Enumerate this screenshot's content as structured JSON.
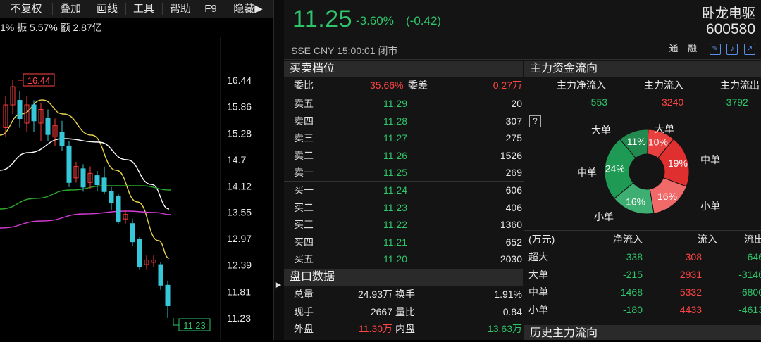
{
  "menu": [
    "不复权",
    "叠加",
    "画线",
    "工具",
    "帮助",
    "F9",
    "隐藏▶"
  ],
  "stat_line": "1% 振 5.57% 额 2.87亿",
  "kline": {
    "price_labels": [
      "16.44",
      "15.86",
      "15.28",
      "14.7",
      "14.12",
      "13.55",
      "12.97",
      "12.39",
      "11.81",
      "11.23"
    ],
    "high_tag": "16.44",
    "low_tag": "11.23",
    "candles": [
      {
        "o": 15.4,
        "c": 15.9,
        "h": 16.1,
        "l": 15.2,
        "up": true
      },
      {
        "o": 15.9,
        "c": 16.3,
        "h": 16.44,
        "l": 15.7,
        "up": true
      },
      {
        "o": 16.0,
        "c": 15.6,
        "h": 16.2,
        "l": 15.4,
        "up": false
      },
      {
        "o": 15.5,
        "c": 15.9,
        "h": 16.1,
        "l": 15.3,
        "up": true
      },
      {
        "o": 15.9,
        "c": 15.55,
        "h": 16.0,
        "l": 15.3,
        "up": false
      },
      {
        "o": 15.5,
        "c": 15.8,
        "h": 15.95,
        "l": 15.1,
        "up": true
      },
      {
        "o": 15.6,
        "c": 15.25,
        "h": 15.8,
        "l": 15.1,
        "up": false
      },
      {
        "o": 15.2,
        "c": 15.45,
        "h": 15.6,
        "l": 15.0,
        "up": true
      },
      {
        "o": 15.3,
        "c": 15.0,
        "h": 15.55,
        "l": 14.9,
        "up": false
      },
      {
        "o": 15.0,
        "c": 14.2,
        "h": 15.1,
        "l": 14.1,
        "up": false
      },
      {
        "o": 14.3,
        "c": 14.55,
        "h": 14.65,
        "l": 14.2,
        "up": true
      },
      {
        "o": 14.5,
        "c": 14.1,
        "h": 14.6,
        "l": 14.0,
        "up": false
      },
      {
        "o": 14.2,
        "c": 14.4,
        "h": 14.55,
        "l": 14.05,
        "up": true
      },
      {
        "o": 14.35,
        "c": 14.15,
        "h": 14.45,
        "l": 14.0,
        "up": false
      },
      {
        "o": 14.3,
        "c": 14.0,
        "h": 14.55,
        "l": 13.95,
        "up": false
      },
      {
        "o": 14.0,
        "c": 13.75,
        "h": 14.1,
        "l": 13.6,
        "up": false
      },
      {
        "o": 13.9,
        "c": 13.35,
        "h": 13.95,
        "l": 13.3,
        "up": false
      },
      {
        "o": 13.4,
        "c": 13.5,
        "h": 13.6,
        "l": 13.3,
        "up": true
      },
      {
        "o": 13.3,
        "c": 12.9,
        "h": 13.4,
        "l": 12.8,
        "up": false
      },
      {
        "o": 12.95,
        "c": 12.35,
        "h": 13.0,
        "l": 12.3,
        "up": false
      },
      {
        "o": 12.4,
        "c": 12.5,
        "h": 12.6,
        "l": 12.3,
        "up": true
      },
      {
        "o": 12.5,
        "c": 12.45,
        "h": 12.6,
        "l": 12.35,
        "up": true
      },
      {
        "o": 12.4,
        "c": 11.95,
        "h": 12.45,
        "l": 11.85,
        "up": false
      },
      {
        "o": 11.95,
        "c": 11.5,
        "h": 12.05,
        "l": 11.23,
        "up": false
      }
    ]
  },
  "quote": {
    "price": "11.25",
    "pct": "-3.60%",
    "change": "(-0.42)",
    "name": "卧龙电驱",
    "code": "600580",
    "exchange_line": "SSE  CNY  15:00:01  闭市",
    "badge1": "通",
    "badge2": "融"
  },
  "orderbook": {
    "title": "买卖档位",
    "ratio_label": "委比",
    "ratio_value": "35.66%",
    "diff_label": "委差",
    "diff_value": "0.27万",
    "asks": [
      {
        "label": "卖五",
        "price": "11.29",
        "vol": "20"
      },
      {
        "label": "卖四",
        "price": "11.28",
        "vol": "307"
      },
      {
        "label": "卖三",
        "price": "11.27",
        "vol": "275"
      },
      {
        "label": "卖二",
        "price": "11.26",
        "vol": "1526"
      },
      {
        "label": "卖一",
        "price": "11.25",
        "vol": "269"
      }
    ],
    "bids": [
      {
        "label": "买一",
        "price": "11.24",
        "vol": "606"
      },
      {
        "label": "买二",
        "price": "11.23",
        "vol": "406"
      },
      {
        "label": "买三",
        "price": "11.22",
        "vol": "1360"
      },
      {
        "label": "买四",
        "price": "11.21",
        "vol": "652"
      },
      {
        "label": "买五",
        "price": "11.20",
        "vol": "2030"
      }
    ]
  },
  "market": {
    "title": "盘口数据",
    "rows": [
      {
        "l1": "总量",
        "v1": "24.93万",
        "l2": "换手",
        "v2": "1.91%"
      },
      {
        "l1": "现手",
        "v1": "2667",
        "l2": "量比",
        "v2": "0.84"
      },
      {
        "l1": "外盘",
        "v1": "11.30万",
        "l2": "内盘",
        "v2": "13.63万"
      }
    ]
  },
  "capital": {
    "title": "主力资金流向",
    "head": [
      "主力净流入",
      "主力流入",
      "主力流出"
    ],
    "values": [
      "-553",
      "3240",
      "-3792"
    ],
    "help": "?",
    "pie": [
      {
        "name": "大单",
        "pct": "10%",
        "value": 10,
        "color": "#e8403e"
      },
      {
        "name": "中单",
        "pct": "19%",
        "value": 19,
        "color": "#e02f2f"
      },
      {
        "name": "小单",
        "pct": "16%",
        "value": 16,
        "color": "#f06a6a"
      },
      {
        "name": "小单",
        "pct": "16%",
        "value": 16,
        "color": "#3fae73"
      },
      {
        "name": "中单",
        "pct": "24%",
        "value": 24,
        "color": "#1f9a55"
      },
      {
        "name": "大单",
        "pct": "11%",
        "value": 11,
        "color": "#22894f"
      }
    ],
    "table_head": [
      "(万元)",
      "净流入",
      "流入",
      "流出"
    ],
    "table": [
      {
        "k": "超大",
        "net": "-338",
        "in": "308",
        "out": "-646"
      },
      {
        "k": "大单",
        "net": "-215",
        "in": "2931",
        "out": "-3146"
      },
      {
        "k": "中单",
        "net": "-1468",
        "in": "5332",
        "out": "-6800"
      },
      {
        "k": "小单",
        "net": "-180",
        "in": "4433",
        "out": "-4613"
      }
    ],
    "history_title": "历史主力流向"
  }
}
